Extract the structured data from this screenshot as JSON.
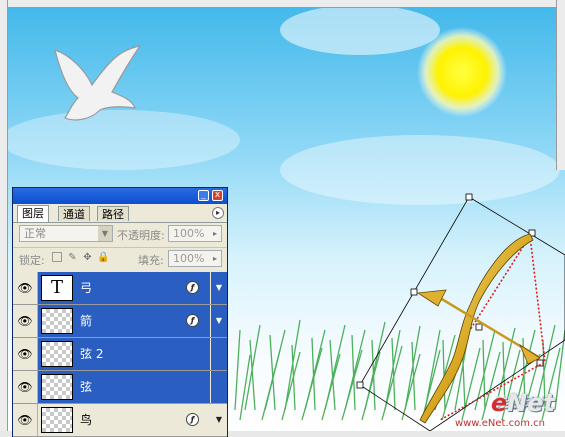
{
  "colors": {
    "selection": "#2a5fc1",
    "panel_bg": "#ece9d8",
    "titlebar": "#0b4fd0",
    "sun": "#fff200"
  },
  "watermark": {
    "brand_e": "e",
    "brand_rest": "Net",
    "cn": "硅谷动力",
    "url": "www.eNet.com.cn"
  },
  "layers_panel": {
    "tabs": [
      "图层",
      "通道",
      "路径"
    ],
    "blend_mode": "正常",
    "opacity_label": "不透明度:",
    "opacity_value": "100%",
    "lock_label": "锁定:",
    "fill_label": "填充:",
    "fill_value": "100%",
    "titlebar_buttons": {
      "minimize": "_",
      "close": "x"
    },
    "menu_icon": "▸",
    "layers": [
      {
        "name": "弓",
        "thumb": "T",
        "kind": "text",
        "eye": "visible-eye-icon",
        "has_fx": true,
        "selected": true
      },
      {
        "name": "箭",
        "thumb": "",
        "kind": "pixel",
        "eye": "visible-eye-icon",
        "has_fx": true,
        "selected": true
      },
      {
        "name": "弦 2",
        "thumb": "",
        "kind": "pixel",
        "eye": "visible-eye-icon",
        "has_fx": false,
        "selected": true
      },
      {
        "name": "弦",
        "thumb": "",
        "kind": "pixel",
        "eye": "visible-eye-icon",
        "has_fx": false,
        "selected": true
      },
      {
        "name": "鸟",
        "thumb": "",
        "kind": "pixel",
        "eye": "visible-eye-icon",
        "has_fx": true,
        "selected": false
      }
    ]
  }
}
